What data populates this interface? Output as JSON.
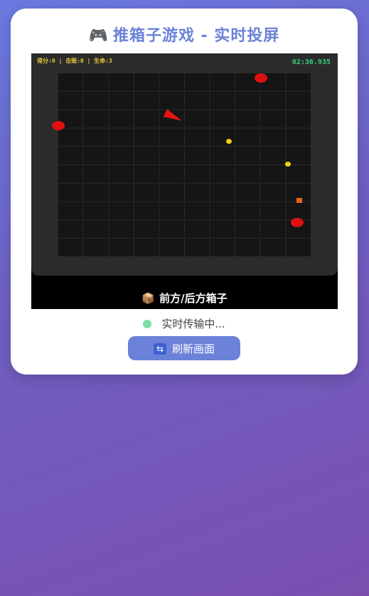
{
  "header": {
    "icon": "gamepad-icon",
    "title": "推箱子游戏 - 实时投屏"
  },
  "game": {
    "hud_stats": "得分:0 | 击毁:0 | 生命:3",
    "timer": "02:36.935",
    "colors": {
      "enemy": "#e01010",
      "coin": "#f1d20f",
      "box": "#e0661a",
      "player": "#e51414",
      "timer": "#37d37a",
      "hud": "#e6c83a"
    }
  },
  "screen_caption": {
    "icon": "box-icon",
    "text": "前方/后方箱子"
  },
  "status": {
    "text": "实时传输中...",
    "indicator_color": "#7fdc9f"
  },
  "refresh_button": {
    "icon": "refresh-icon",
    "label": "刷新画面"
  }
}
